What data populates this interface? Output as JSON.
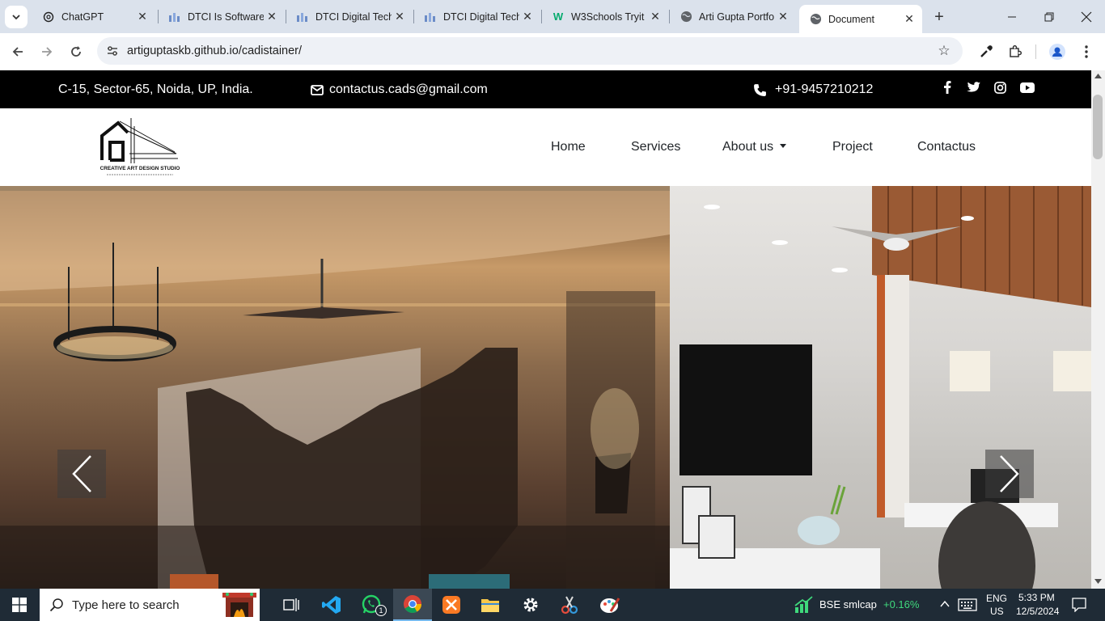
{
  "browser": {
    "tabs": [
      {
        "title": "ChatGPT",
        "icon": "chatgpt-icon"
      },
      {
        "title": "DTCI Is Software",
        "icon": "dtci-icon"
      },
      {
        "title": "DTCI Digital Tech",
        "icon": "dtci-icon"
      },
      {
        "title": "DTCI Digital Tech",
        "icon": "dtci-icon"
      },
      {
        "title": "W3Schools Tryit",
        "icon": "w3schools-icon"
      },
      {
        "title": "Arti Gupta Portfo",
        "icon": "globe-icon"
      },
      {
        "title": "Document",
        "icon": "globe-icon",
        "active": true
      }
    ],
    "url": "artiguptaskb.github.io/cadistainer/"
  },
  "site": {
    "topbar": {
      "address": "C-15, Sector-65, Noida, UP, India.",
      "email": "contactus.cads@gmail.com",
      "phone": "+91-9457210212",
      "social_icons": [
        "facebook-icon",
        "twitter-icon",
        "instagram-icon",
        "youtube-icon"
      ]
    },
    "logo": {
      "name": "CREATIVE ART DESIGN STUDIO"
    },
    "nav": [
      {
        "label": "Home"
      },
      {
        "label": "Services"
      },
      {
        "label": "About us",
        "dropdown": true
      },
      {
        "label": "Project"
      },
      {
        "label": "Contactus"
      }
    ],
    "carousel": {
      "prev_icon": "chevron-left-icon",
      "next_icon": "chevron-right-icon"
    }
  },
  "taskbar": {
    "search_placeholder": "Type here to search",
    "stock": {
      "name": "BSE smlcap",
      "change": "+0.16%"
    },
    "lang": "ENG",
    "region": "US",
    "time": "5:33 PM",
    "date": "12/5/2024",
    "whatsapp_badge": "1"
  },
  "colors": {
    "topbar_bg": "#000000",
    "tabstrip_bg": "#dbe2ec",
    "taskbar_bg": "#1f2b36",
    "stock_up": "#3fd97c"
  }
}
